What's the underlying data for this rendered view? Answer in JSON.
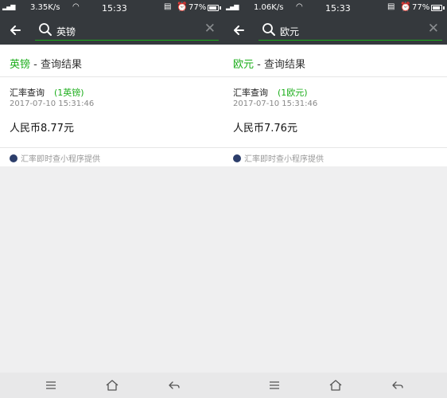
{
  "screens": [
    {
      "status_bar": {
        "signal": "ᵢ₄ᵢ·46ᵢ",
        "speed": "3.35K/s",
        "time": "15:33",
        "battery": "77%"
      },
      "search": {
        "query": "英镑"
      },
      "result": {
        "title_keyword": "英镑",
        "title_suffix": " - 查询结果",
        "card_title": "汇率查询",
        "card_tag": "(1英镑)",
        "timestamp": "2017-07-10 15:31:46",
        "value": "人民币8.77元",
        "provider": "汇率即时查小程序提供"
      }
    },
    {
      "status_bar": {
        "signal": "ᵢ₄ᵢ·46ᵢ",
        "speed": "1.06K/s",
        "time": "15:33",
        "battery": "77%"
      },
      "search": {
        "query": "欧元"
      },
      "result": {
        "title_keyword": "欧元",
        "title_suffix": " - 查询结果",
        "card_title": "汇率查询",
        "card_tag": "(1欧元)",
        "timestamp": "2017-07-10 15:31:46",
        "value": "人民币7.76元",
        "provider": "汇率即时查小程序提供"
      }
    }
  ],
  "icons": {
    "back": "arrow-left-icon",
    "search": "search-icon",
    "clear": "close-icon",
    "menu": "menu-icon",
    "home": "home-icon",
    "nav_back": "back-icon"
  },
  "colors": {
    "header_bg": "#35393d",
    "accent": "#1aad19",
    "page_bg": "#efeff0",
    "nav_bg": "#e8e8e9"
  }
}
